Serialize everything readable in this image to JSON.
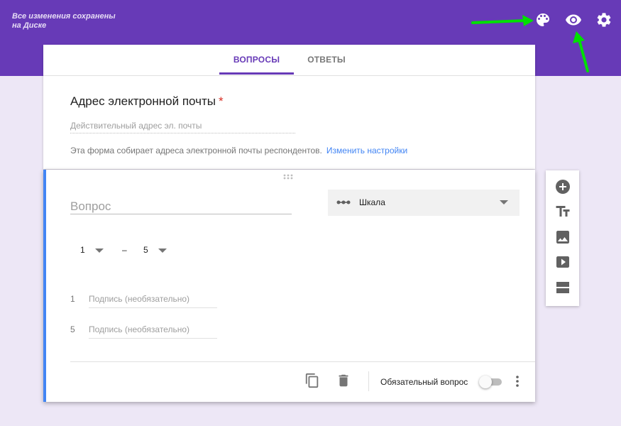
{
  "header": {
    "save_status": "Все изменения сохранены на Диске",
    "icons": [
      "palette-icon",
      "preview-eye-icon",
      "settings-gear-icon"
    ],
    "background": "#673ab7"
  },
  "tabs": [
    {
      "label": "ВОПРОСЫ",
      "active": true
    },
    {
      "label": "ОТВЕТЫ",
      "active": false
    }
  ],
  "email_section": {
    "title": "Адрес электронной почты",
    "required_mark": "*",
    "placeholder": "Действительный адрес эл. почты",
    "note": "Эта форма собирает адреса электронной почты респондентов.",
    "settings_link": "Изменить настройки"
  },
  "question": {
    "title_placeholder": "Вопрос",
    "type_label": "Шкала",
    "type_icon": "linear-scale-icon",
    "range_from": "1",
    "range_separator": "–",
    "range_to": "5",
    "labels": [
      {
        "number": "1",
        "placeholder": "Подпись (необязательно)"
      },
      {
        "number": "5",
        "placeholder": "Подпись (необязательно)"
      }
    ],
    "required_label": "Обязательный вопрос",
    "required_on": false,
    "accent_color": "#4285f4"
  },
  "side_toolbar": {
    "icons": [
      "add-question-icon",
      "add-title-icon",
      "add-image-icon",
      "add-video-icon",
      "add-section-icon"
    ]
  },
  "annotation_color": "#00e000"
}
